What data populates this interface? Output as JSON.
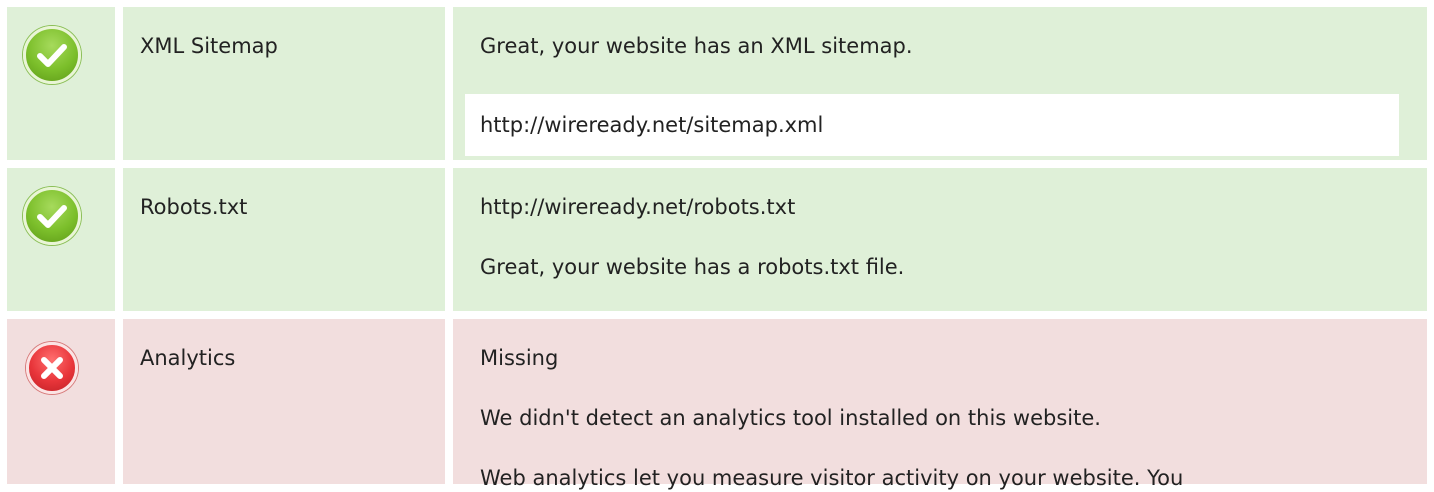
{
  "colors": {
    "pass_bg": "#dff0d8",
    "fail_bg": "#f2dede",
    "pass_icon": "#7cbf2b",
    "fail_icon": "#e8353a"
  },
  "checks": [
    {
      "status": "pass",
      "icon": "check-circle-icon",
      "name": "XML Sitemap",
      "message": "Great, your website has an XML sitemap.",
      "url": "http://wireready.net/sitemap.xml"
    },
    {
      "status": "pass",
      "icon": "check-circle-icon",
      "name": "Robots.txt",
      "url": "http://wireready.net/robots.txt",
      "message": "Great, your website has a robots.txt file."
    },
    {
      "status": "fail",
      "icon": "cross-circle-icon",
      "name": "Analytics",
      "result": "Missing",
      "message": "We didn't detect an analytics tool installed on this website.",
      "description": "Web analytics let you measure visitor activity on your website. You"
    }
  ]
}
